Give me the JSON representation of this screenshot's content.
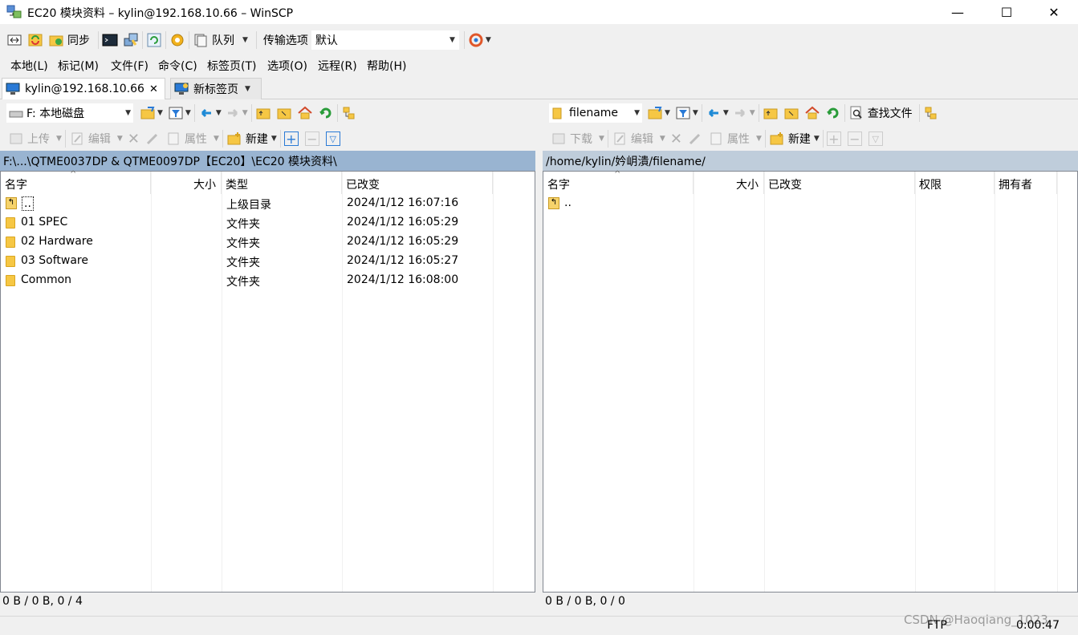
{
  "window": {
    "title": "EC20 模块资料 – kylin@192.168.10.66 – WinSCP"
  },
  "toolbar": {
    "sync_label": "同步",
    "queue_label": "队列",
    "transfer_label": "传输选项",
    "transfer_value": "默认"
  },
  "menu": [
    "本地(L)",
    "标记(M)",
    "文件(F)",
    "命令(C)",
    "标签页(T)",
    "选项(O)",
    "远程(R)",
    "帮助(H)"
  ],
  "tabs": [
    {
      "label": "kylin@192.168.10.66"
    },
    {
      "label": "新标签页"
    }
  ],
  "left": {
    "drive": "F: 本地磁盘",
    "upload_label": "上传",
    "edit_label": "编辑",
    "props_label": "属性",
    "new_label": "新建",
    "path": "F:\\...\\QTME0037DP & QTME0097DP【EC20】\\EC20 模块资料\\",
    "columns": [
      "名字",
      "大小",
      "类型",
      "已改变"
    ],
    "rows": [
      {
        "name": "..",
        "size": "",
        "type": "上级目录",
        "changed": "2024/1/12 16:07:16"
      },
      {
        "name": "01 SPEC",
        "size": "",
        "type": "文件夹",
        "changed": "2024/1/12 16:05:29"
      },
      {
        "name": "02 Hardware",
        "size": "",
        "type": "文件夹",
        "changed": "2024/1/12 16:05:29"
      },
      {
        "name": "03 Software",
        "size": "",
        "type": "文件夹",
        "changed": "2024/1/12 16:05:27"
      },
      {
        "name": "Common",
        "size": "",
        "type": "文件夹",
        "changed": "2024/1/12 16:08:00"
      }
    ],
    "status": "0 B / 0 B,   0 / 4"
  },
  "right": {
    "folder": "filename",
    "find_label": "查找文件",
    "download_label": "下载",
    "edit_label": "编辑",
    "props_label": "属性",
    "new_label": "新建",
    "path": "/home/kylin/妗岄潰/filename/",
    "columns": [
      "名字",
      "大小",
      "已改变",
      "权限",
      "拥有者"
    ],
    "rows": [
      {
        "name": ".."
      }
    ],
    "status": "0 B / 0 B,   0 / 0"
  },
  "statusbar": {
    "protocol": "FTP",
    "time": "0:00:47",
    "watermark": "CSDN @Haoqiang_1023"
  }
}
